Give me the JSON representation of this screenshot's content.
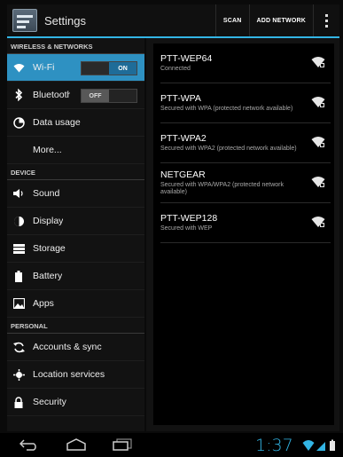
{
  "app": {
    "title": "Settings",
    "actions": [
      "SCAN",
      "ADD NETWORK"
    ]
  },
  "sidebar": {
    "sections": [
      {
        "header": "WIRELESS & NETWORKS",
        "items": [
          {
            "label": "Wi-Fi",
            "icon": "wifi-icon",
            "toggle": "ON",
            "selected": true
          },
          {
            "label": "Bluetooth",
            "icon": "bluetooth-icon",
            "toggle": "OFF"
          },
          {
            "label": "Data usage",
            "icon": "data-usage-icon"
          },
          {
            "label": "More...",
            "icon": ""
          }
        ]
      },
      {
        "header": "DEVICE",
        "items": [
          {
            "label": "Sound",
            "icon": "sound-icon"
          },
          {
            "label": "Display",
            "icon": "display-icon"
          },
          {
            "label": "Storage",
            "icon": "storage-icon"
          },
          {
            "label": "Battery",
            "icon": "battery-icon"
          },
          {
            "label": "Apps",
            "icon": "apps-icon"
          }
        ]
      },
      {
        "header": "PERSONAL",
        "items": [
          {
            "label": "Accounts & sync",
            "icon": "sync-icon"
          },
          {
            "label": "Location services",
            "icon": "location-icon"
          },
          {
            "label": "Security",
            "icon": "lock-icon"
          }
        ]
      }
    ]
  },
  "networks": [
    {
      "name": "PTT-WEP64",
      "status": "Connected"
    },
    {
      "name": "PTT-WPA",
      "status": "Secured with WPA (protected network available)"
    },
    {
      "name": "PTT-WPA2",
      "status": "Secured with WPA2 (protected network available)"
    },
    {
      "name": "NETGEAR",
      "status": "Secured with WPA/WPA2 (protected network available)"
    },
    {
      "name": "PTT-WEP128",
      "status": "Secured with WEP"
    }
  ],
  "statusbar": {
    "time": "1:37"
  },
  "colors": {
    "accent": "#33b5e5",
    "selected": "#2e91c2"
  }
}
